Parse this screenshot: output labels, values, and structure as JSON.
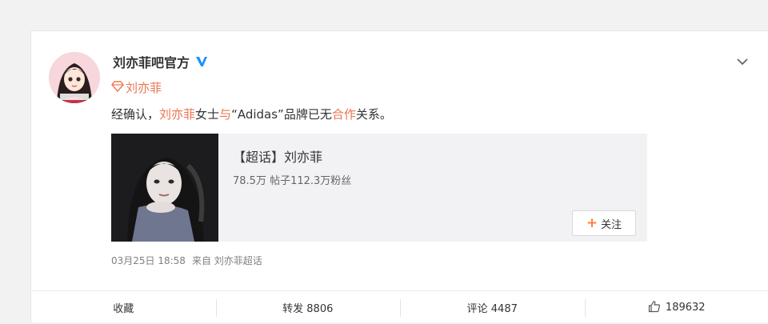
{
  "post": {
    "author": "刘亦菲吧官方",
    "topic_tag": "刘亦菲",
    "text_parts": [
      "经确认，",
      "刘亦菲",
      "女士",
      "与",
      "“Adidas”品牌已无",
      "合作",
      "关系。"
    ],
    "embed": {
      "title": "【超话】刘亦菲",
      "stats": "78.5万 帖子112.3万粉丝",
      "follow_label": "关注"
    },
    "time": "03月25日 18:58",
    "source": "来自 刘亦菲超话"
  },
  "actions": {
    "favorite": "收藏",
    "repost": "转发 8806",
    "comment": "评论 4487",
    "like_count": "189632"
  },
  "colors": {
    "highlight": "#eb7350",
    "verified": "#1e90ff",
    "follow_plus": "#ff8140"
  },
  "icons": [
    "avatar",
    "verified-icon",
    "chevron-down-icon",
    "supertopic-icon",
    "plus-icon",
    "thumbs-up-icon"
  ]
}
